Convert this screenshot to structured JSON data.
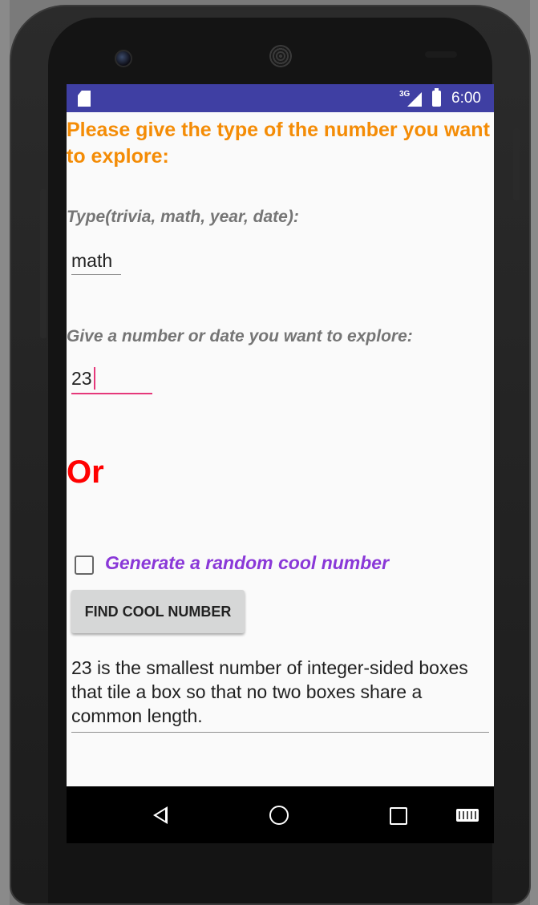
{
  "status_bar": {
    "network": "3G",
    "time": "6:00"
  },
  "heading": "Please give the type of the number you want to explore:",
  "type_field": {
    "label": "Type(trivia, math, year, date):",
    "value": "math"
  },
  "number_field": {
    "label": "Give a number or date you want to explore:",
    "value": "23"
  },
  "or_text": "Or",
  "random_checkbox": {
    "label": "Generate a random cool number",
    "checked": false
  },
  "find_button": {
    "label": "FIND COOL NUMBER"
  },
  "result_text": "23 is the smallest number of integer-sided boxes that tile a box so that no two boxes share a common length.",
  "navigation": {
    "icons": [
      "back-icon",
      "home-icon",
      "recents-icon",
      "keyboard-icon"
    ]
  },
  "colors": {
    "status_bar": "#3f3fa3",
    "heading": "#f48c06",
    "or_text": "#ff0000",
    "checkbox_label": "#8a38d8",
    "active_input": "#e5387a"
  }
}
